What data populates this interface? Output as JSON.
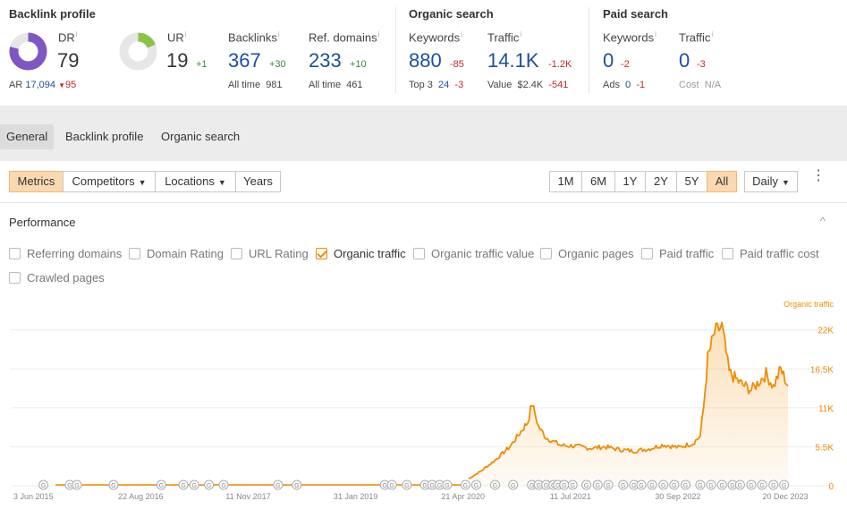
{
  "backlink": {
    "title": "Backlink profile",
    "dr": {
      "label": "DR",
      "info": "i",
      "value": "79",
      "fraction": 0.79
    },
    "ar": {
      "label": "AR",
      "value": "17,094",
      "delta": "95"
    },
    "ur": {
      "label": "UR",
      "info": "i",
      "value": "19",
      "delta": "+1",
      "fraction": 0.19
    },
    "backlinks": {
      "label": "Backlinks",
      "info": "i",
      "value": "367",
      "delta": "+30",
      "alltime_label": "All time",
      "alltime_value": "981"
    },
    "refdomains": {
      "label": "Ref. domains",
      "info": "i",
      "value": "233",
      "delta": "+10",
      "alltime_label": "All time",
      "alltime_value": "461"
    }
  },
  "organic": {
    "title": "Organic search",
    "keywords": {
      "label": "Keywords",
      "info": "i",
      "value": "880",
      "delta": "-85",
      "top3_label": "Top 3",
      "top3_value": "24",
      "top3_delta": "-3"
    },
    "traffic": {
      "label": "Traffic",
      "info": "i",
      "value": "14.1K",
      "delta": "-1.2K",
      "value_label": "Value",
      "value_value": "$2.4K",
      "value_delta": "-541"
    }
  },
  "paid": {
    "title": "Paid search",
    "keywords": {
      "label": "Keywords",
      "info": "i",
      "value": "0",
      "delta": "-2",
      "ads_label": "Ads",
      "ads_value": "0",
      "ads_delta": "-1"
    },
    "traffic": {
      "label": "Traffic",
      "info": "i",
      "value": "0",
      "delta": "-3",
      "cost_label": "Cost",
      "cost_value": "N/A"
    }
  },
  "nav_tabs": [
    "General",
    "Backlink profile",
    "Organic search"
  ],
  "toolbar": {
    "left": [
      "Metrics",
      "Competitors",
      "Locations",
      "Years"
    ],
    "ranges": [
      "1M",
      "6M",
      "1Y",
      "2Y",
      "5Y",
      "All"
    ],
    "interval": "Daily",
    "more": "⋮"
  },
  "performance": {
    "title": "Performance",
    "collapse_icon": "^",
    "checkboxes": [
      {
        "label": "Referring domains",
        "checked": false
      },
      {
        "label": "Domain Rating",
        "checked": false
      },
      {
        "label": "URL Rating",
        "checked": false
      },
      {
        "label": "Organic traffic",
        "checked": true
      },
      {
        "label": "Organic traffic value",
        "checked": false
      },
      {
        "label": "Organic pages",
        "checked": false
      },
      {
        "label": "Paid traffic",
        "checked": false
      },
      {
        "label": "Paid traffic cost",
        "checked": false
      },
      {
        "label": "Crawled pages",
        "checked": false
      }
    ]
  },
  "colors": {
    "accent": "#f08c00",
    "blue": "#1c4fa0",
    "purple": "#7e57c2",
    "green": "#8bc34a",
    "negative": "#c62828",
    "positive": "#3a8a3a"
  },
  "chart_data": {
    "type": "area",
    "series": [
      {
        "name": "Organic traffic",
        "x": [
          "2020-05-15",
          "2020-07-01",
          "2020-09-01",
          "2020-11-01",
          "2021-01-15",
          "2021-02-01",
          "2021-02-15",
          "2021-03-01",
          "2021-04-01",
          "2021-06-01",
          "2021-08-01",
          "2021-10-01",
          "2021-12-01",
          "2022-02-01",
          "2022-04-01",
          "2022-06-01",
          "2022-08-01",
          "2022-10-01",
          "2022-12-01",
          "2023-01-01",
          "2023-01-15",
          "2023-02-01",
          "2023-03-01",
          "2023-04-01",
          "2023-05-01",
          "2023-06-15",
          "2023-08-01",
          "2023-10-01",
          "2023-11-01",
          "2023-12-01",
          "2023-12-31"
        ],
        "values": [
          1000,
          2000,
          3600,
          5500,
          9000,
          11600,
          10000,
          8300,
          6800,
          5700,
          5600,
          5300,
          5500,
          5100,
          4900,
          5200,
          5800,
          5400,
          6000,
          7000,
          11000,
          18000,
          21500,
          22500,
          16000,
          14500,
          13500,
          15800,
          14000,
          16500,
          14100
        ]
      }
    ],
    "y_ticks": [
      22000,
      16500,
      11000,
      5500,
      0
    ],
    "y_tick_labels": [
      "22K",
      "16.5K",
      "11K",
      "5.5K",
      "0"
    ],
    "ylim": [
      0,
      26000
    ],
    "x_tick_labels": [
      "3 Jun 2015",
      "22 Aug 2016",
      "11 Nov 2017",
      "31 Jan 2019",
      "21 Apr 2020",
      "11 Jul 2021",
      "30 Sep 2022",
      "20 Dec 2023"
    ],
    "x_tick_dates": [
      "2015-06-03",
      "2016-08-22",
      "2017-11-11",
      "2019-01-31",
      "2020-04-21",
      "2021-07-11",
      "2022-09-30",
      "2023-12-20"
    ],
    "xlim": [
      "2015-03-01",
      "2024-01-15"
    ],
    "legend_label": "Organic traffic",
    "legend_position": "top-right",
    "grid": true,
    "annotation_marker": "G",
    "annotation_dates": [
      "2015-07-15",
      "2015-11-01",
      "2015-12-01",
      "2016-05-01",
      "2016-11-15",
      "2017-02-15",
      "2017-04-01",
      "2017-06-01",
      "2017-08-01",
      "2018-03-15",
      "2018-06-01",
      "2019-06-01",
      "2019-07-01",
      "2019-09-01",
      "2019-11-15",
      "2019-12-15",
      "2020-01-15",
      "2020-02-15",
      "2020-05-01",
      "2020-06-15",
      "2020-09-01",
      "2020-11-15",
      "2021-02-01",
      "2021-03-01",
      "2021-04-01",
      "2021-05-01",
      "2021-05-20",
      "2021-06-15",
      "2021-07-20",
      "2021-09-15",
      "2021-11-01",
      "2021-12-15",
      "2022-02-15",
      "2022-04-01",
      "2022-05-01",
      "2022-06-15",
      "2022-08-01",
      "2022-09-15",
      "2022-11-01",
      "2023-01-01",
      "2023-02-15",
      "2023-04-01",
      "2023-05-15",
      "2023-06-15",
      "2023-08-01",
      "2023-09-15",
      "2023-11-01",
      "2023-12-15"
    ]
  }
}
